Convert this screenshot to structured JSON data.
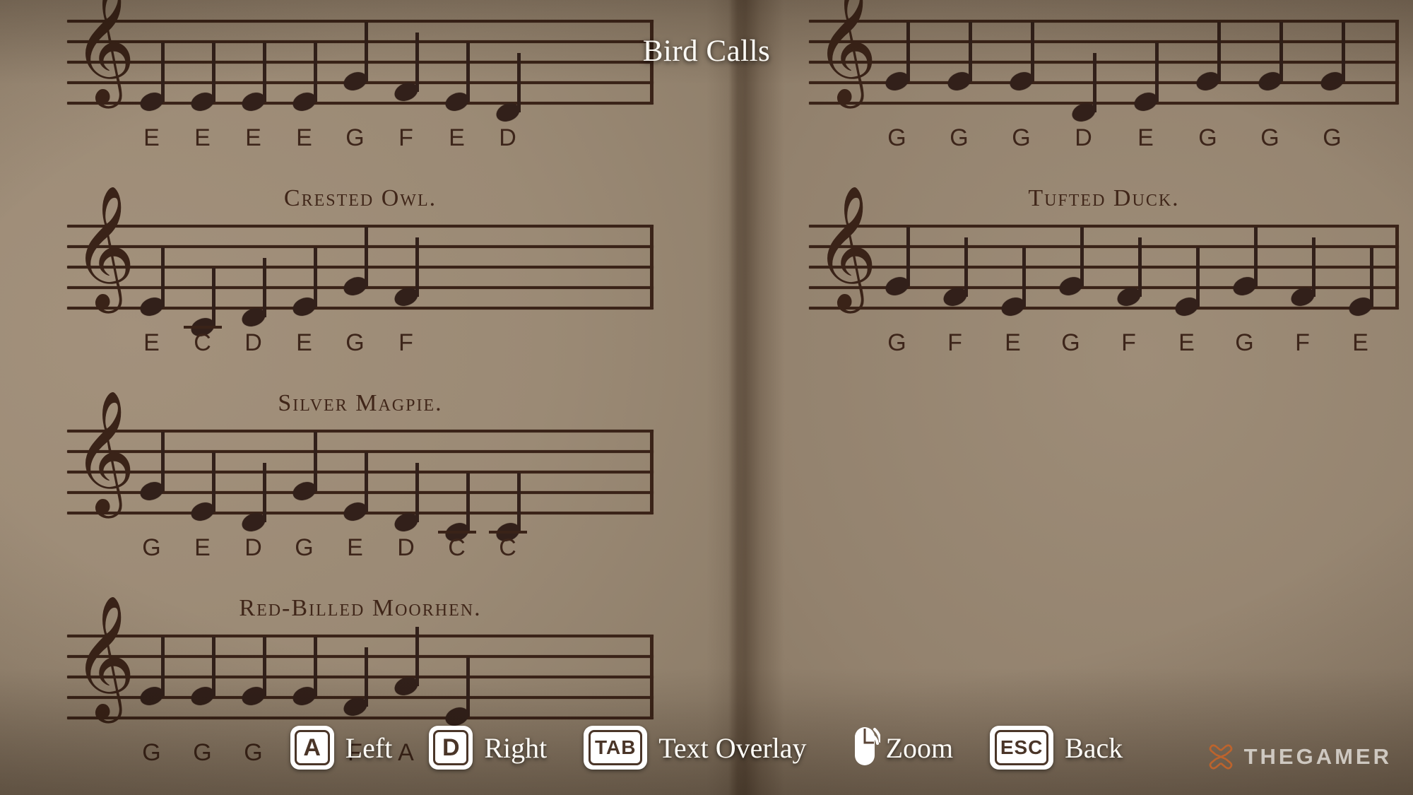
{
  "title": "Bird Calls",
  "colors": {
    "ink": "#3a2318",
    "paper_left": "#9b8a75",
    "paper_right": "#93826e",
    "overlay_text": "#fdfbf6",
    "key_fill": "#ffffff",
    "key_ink": "#4a3528",
    "watermark_logo": "#c4642a",
    "watermark_text": "#d7d2cb"
  },
  "systems": [
    {
      "id": "top-left",
      "bird": null,
      "notes": [
        "E",
        "E",
        "E",
        "E",
        "G",
        "F",
        "E",
        "D"
      ],
      "steps": [
        0,
        0,
        0,
        0,
        2,
        1,
        0,
        -1
      ]
    },
    {
      "id": "crested-owl",
      "bird": "Crested Owl.",
      "notes": [
        "E",
        "C",
        "D",
        "E",
        "G",
        "F"
      ],
      "steps": [
        0,
        -2,
        -1,
        0,
        2,
        1
      ]
    },
    {
      "id": "silver-magpie",
      "bird": "Silver Magpie.",
      "notes": [
        "G",
        "E",
        "D",
        "G",
        "E",
        "D",
        "C",
        "C"
      ],
      "steps": [
        2,
        0,
        -1,
        2,
        0,
        -1,
        -2,
        -2
      ]
    },
    {
      "id": "red-billed-moorhen",
      "bird": "Red-Billed Moorhen.",
      "notes": [
        "G",
        "G",
        "G",
        "G",
        "F",
        "A",
        "E"
      ],
      "steps": [
        2,
        2,
        2,
        2,
        1,
        3,
        0
      ]
    },
    {
      "id": "top-right",
      "bird": null,
      "notes": [
        "G",
        "G",
        "G",
        "D",
        "E",
        "G",
        "G",
        "G"
      ],
      "steps": [
        2,
        2,
        2,
        -1,
        0,
        2,
        2,
        2
      ]
    },
    {
      "id": "tufted-duck",
      "bird": "Tufted Duck.",
      "notes": [
        "G",
        "F",
        "E",
        "G",
        "F",
        "E",
        "G",
        "F",
        "E"
      ],
      "steps": [
        2,
        1,
        0,
        2,
        1,
        0,
        2,
        1,
        0
      ]
    }
  ],
  "hints": [
    {
      "key": "A",
      "key_style": "sq",
      "label": "Left",
      "icon": null
    },
    {
      "key": "D",
      "key_style": "sq",
      "label": "Right",
      "icon": null
    },
    {
      "key": "TAB",
      "key_style": "wide",
      "label": "Text Overlay",
      "icon": null
    },
    {
      "key": null,
      "key_style": null,
      "label": "Zoom",
      "icon": "mouse-scroll-icon"
    },
    {
      "key": "ESC",
      "key_style": "wide",
      "label": "Back",
      "icon": null
    }
  ],
  "watermark": {
    "text": "THEGAMER",
    "logo": "thegamer-logo-icon"
  }
}
